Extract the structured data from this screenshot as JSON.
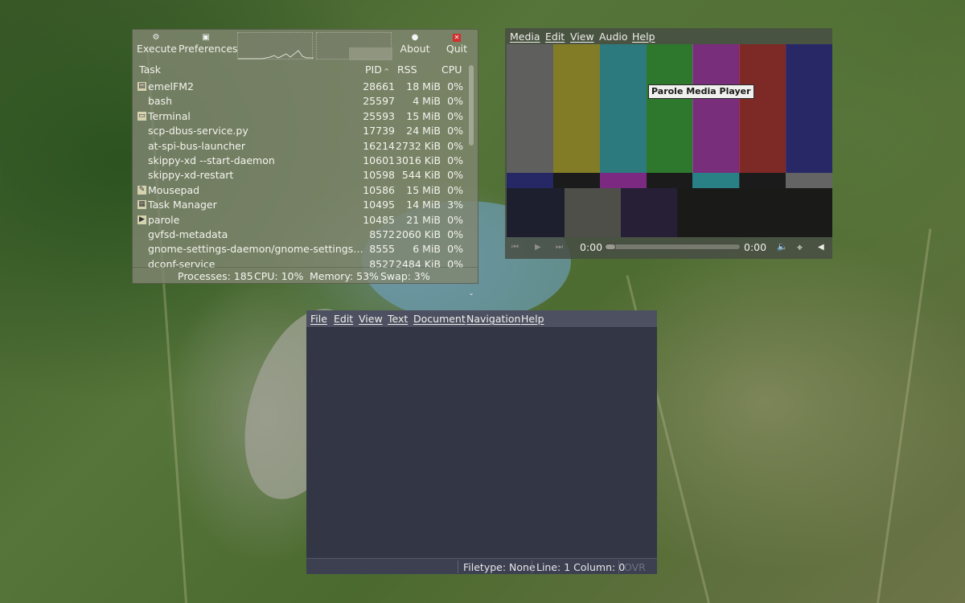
{
  "task_manager": {
    "toolbar": {
      "execute": "Execute",
      "preferences": "Preferences",
      "about": "About",
      "quit": "Quit"
    },
    "columns": {
      "task": "Task",
      "pid": "PID",
      "rss": "RSS",
      "cpu": "CPU"
    },
    "rows": [
      {
        "name": "emelFM2",
        "pid": "28661",
        "rss": "18 MiB",
        "cpu": "0%",
        "icon": "file-manager-icon"
      },
      {
        "name": "bash",
        "pid": "25597",
        "rss": "4 MiB",
        "cpu": "0%",
        "icon": ""
      },
      {
        "name": "Terminal",
        "pid": "25593",
        "rss": "15 MiB",
        "cpu": "0%",
        "icon": "terminal-icon"
      },
      {
        "name": "scp-dbus-service.py",
        "pid": "17739",
        "rss": "24 MiB",
        "cpu": "0%",
        "icon": ""
      },
      {
        "name": "at-spi-bus-launcher",
        "pid": "16214",
        "rss": "2732 KiB",
        "cpu": "0%",
        "icon": ""
      },
      {
        "name": "skippy-xd --start-daemon",
        "pid": "10601",
        "rss": "3016 KiB",
        "cpu": "0%",
        "icon": ""
      },
      {
        "name": "skippy-xd-restart",
        "pid": "10598",
        "rss": "544 KiB",
        "cpu": "0%",
        "icon": ""
      },
      {
        "name": "Mousepad",
        "pid": "10586",
        "rss": "15 MiB",
        "cpu": "0%",
        "icon": "text-editor-icon"
      },
      {
        "name": "Task Manager",
        "pid": "10495",
        "rss": "14 MiB",
        "cpu": "3%",
        "icon": "task-manager-icon"
      },
      {
        "name": "parole",
        "pid": "10485",
        "rss": "21 MiB",
        "cpu": "0%",
        "icon": "media-player-icon"
      },
      {
        "name": "gvfsd-metadata",
        "pid": "8572",
        "rss": "2060 KiB",
        "cpu": "0%",
        "icon": ""
      },
      {
        "name": "gnome-settings-daemon/gnome-settings-dae...",
        "pid": "8555",
        "rss": "6 MiB",
        "cpu": "0%",
        "icon": ""
      },
      {
        "name": "dconf-service",
        "pid": "8527",
        "rss": "2484 KiB",
        "cpu": "0%",
        "icon": ""
      }
    ],
    "status": {
      "processes": "Processes: 185",
      "cpu": "CPU: 10%",
      "memory": "Memory: 53%",
      "swap": "Swap: 3%"
    }
  },
  "parole": {
    "menu": {
      "media": "Media",
      "edit": "Edit",
      "view": "View",
      "audio": "Audio",
      "help": "Help"
    },
    "tooltip": "Parole Media Player",
    "time_elapsed": "0:00",
    "time_total": "0:00",
    "seek_position": 0,
    "colors": {
      "bar_top": [
        "#8c8c8c",
        "#c7bd31",
        "#37b9c1",
        "#3bb53a",
        "#b53bbd",
        "#be3431",
        "#30319a"
      ],
      "bar_mid": [
        "#2d2e8e",
        "#1a1a1a",
        "#b02fb8",
        "#1a1a1a",
        "#33b7bf",
        "#1a1a1a",
        "#8a8a8a"
      ]
    }
  },
  "mousepad": {
    "menu": {
      "file": "File",
      "edit": "Edit",
      "view": "View",
      "text": "Text",
      "document": "Document",
      "navigation": "Navigation",
      "help": "Help"
    },
    "status": {
      "filetype": "Filetype: None",
      "position": "Line: 1 Column: 0",
      "mode": "OVR"
    }
  }
}
